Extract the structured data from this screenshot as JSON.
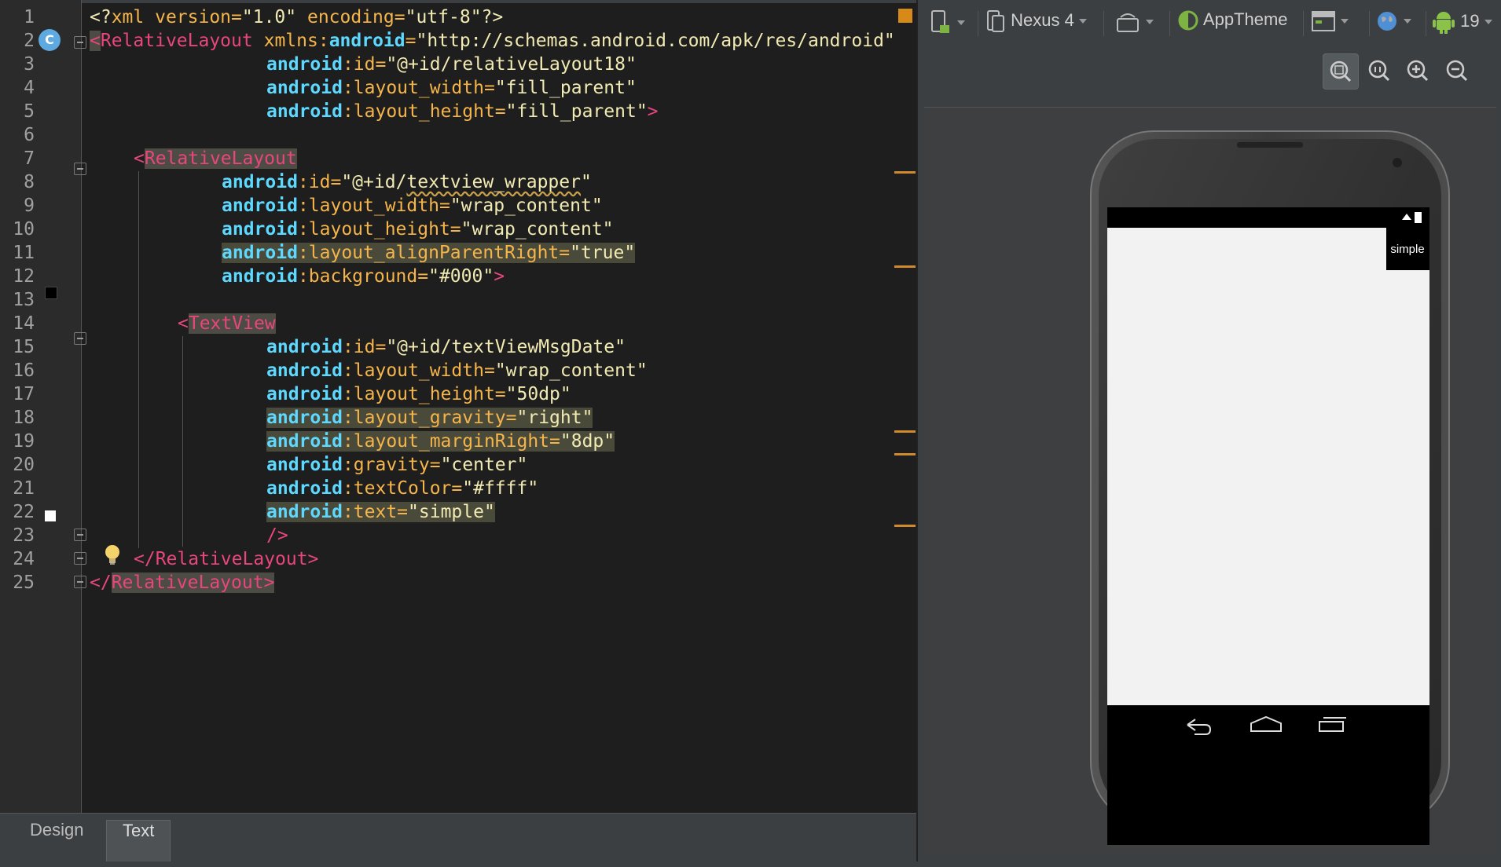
{
  "editor": {
    "line_numbers": [
      "1",
      "2",
      "3",
      "4",
      "5",
      "6",
      "7",
      "8",
      "9",
      "10",
      "11",
      "12",
      "13",
      "14",
      "15",
      "16",
      "17",
      "18",
      "19",
      "20",
      "21",
      "22",
      "23",
      "24",
      "25"
    ],
    "lines": {
      "l1": {
        "pi_open": "<?",
        "pi_name": "xml",
        "v_attr": " version=",
        "v_val": "\"1.0\"",
        "e_attr": " encoding=",
        "e_val": "\"utf-8\"",
        "pi_close": "?>"
      },
      "l2": {
        "lt": "<",
        "tag": "RelativeLayout",
        "sp": " ",
        "ns_attr": "xmlns:",
        "ns": "android",
        "eq": "=",
        "val": "\"http://schemas.android.com/apk/res/android\""
      },
      "l3": {
        "ns": "android",
        "attr": ":id=",
        "val": "\"@+id/relativeLayout18\""
      },
      "l4": {
        "ns": "android",
        "attr": ":layout_width=",
        "val": "\"fill_parent\""
      },
      "l5": {
        "ns": "android",
        "attr": ":layout_height=",
        "val": "\"fill_parent\"",
        "close": ">"
      },
      "l7": {
        "lt": "<",
        "tag": "RelativeLayout"
      },
      "l8": {
        "ns": "android",
        "attr": ":id=",
        "q1": "\"@+id/",
        "val_sq": "textview_wrapper",
        "q2": "\""
      },
      "l9": {
        "ns": "android",
        "attr": ":layout_width=",
        "val": "\"wrap_content\""
      },
      "l10": {
        "ns": "android",
        "attr": ":layout_height=",
        "val": "\"wrap_content\""
      },
      "l11": {
        "ns": "android",
        "attr": ":layout_alignParentRight=",
        "val": "\"true\""
      },
      "l12": {
        "ns": "android",
        "attr": ":background=",
        "val": "\"#000\"",
        "close": ">"
      },
      "l14": {
        "lt": "<",
        "tag": "TextView"
      },
      "l15": {
        "ns": "android",
        "attr": ":id=",
        "val": "\"@+id/textViewMsgDate\""
      },
      "l16": {
        "ns": "android",
        "attr": ":layout_width=",
        "val": "\"wrap_content\""
      },
      "l17": {
        "ns": "android",
        "attr": ":layout_height=",
        "val": "\"50dp\""
      },
      "l18": {
        "ns": "android",
        "attr": ":layout_gravity=",
        "val": "\"right\""
      },
      "l19": {
        "ns": "android",
        "attr": ":layout_marginRight=",
        "val": "\"8dp\""
      },
      "l20": {
        "ns": "android",
        "attr": ":gravity=",
        "val": "\"center\""
      },
      "l21": {
        "ns": "android",
        "attr": ":textColor=",
        "val": "\"#ffff\""
      },
      "l22": {
        "ns": "android",
        "attr": ":text=",
        "val": "\"simple\""
      },
      "l23": {
        "close": "/>"
      },
      "l24": {
        "tag": "</RelativeLayout>"
      },
      "l25": {
        "lt": "</",
        "tag": "RelativeLayout",
        "gt": ">"
      }
    },
    "badge_letter": "C",
    "swatch_colors": {
      "line12": "#000000",
      "line21": "#ffffff"
    }
  },
  "tabs": {
    "design": "Design",
    "text": "Text",
    "active": "Text"
  },
  "toolbar": {
    "device": "Nexus 4",
    "theme": "AppTheme",
    "api": "19"
  },
  "phone": {
    "textview_text": "simple"
  },
  "colors": {
    "tag": "#e8467c",
    "namespace": "#5dd8ff",
    "attribute": "#f6b54a",
    "string": "#f1eab2",
    "editor_bg": "#1e1e1e",
    "panel_bg": "#3c3f41"
  }
}
